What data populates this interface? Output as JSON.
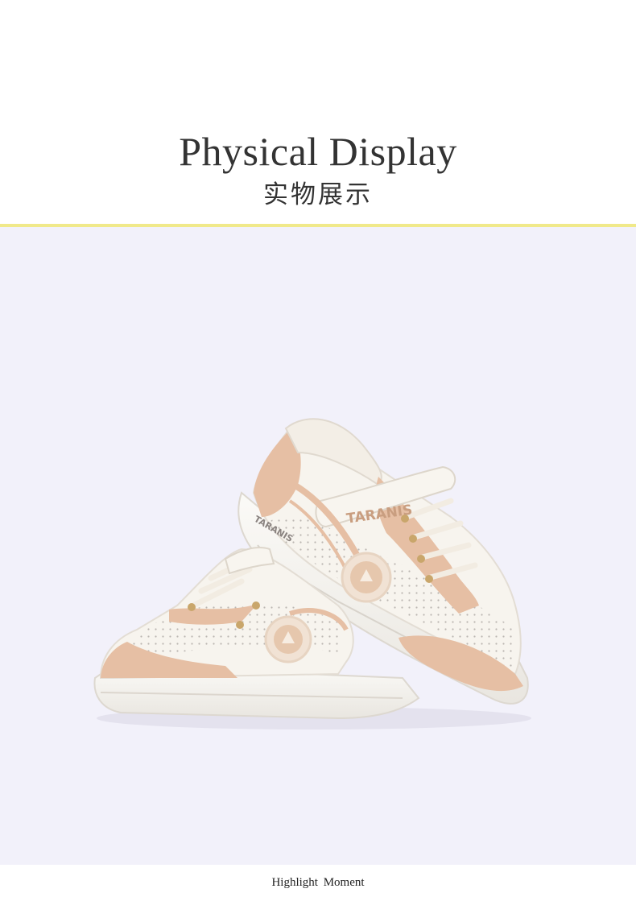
{
  "header": {
    "title_en": "Physical Display",
    "title_cn": "实物展示"
  },
  "product_photo": {
    "brand_label": "TARANIS",
    "side_logo": "TARANIS",
    "colors": {
      "background": "#f2f1fa",
      "shoe_white": "#f7f4ee",
      "accent_tan": "#e6bfa4",
      "divider": "#f0e98a"
    }
  },
  "footer": {
    "caption": "Highlight  Moment"
  }
}
